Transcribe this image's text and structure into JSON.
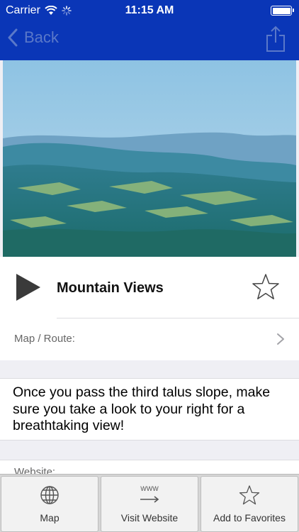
{
  "status_bar": {
    "carrier": "Carrier",
    "time": "11:15 AM"
  },
  "nav": {
    "back_label": "Back"
  },
  "item": {
    "title": "Mountain Views",
    "map_label": "Map / Route:",
    "description": "Once you pass the third talus slope, make sure you take a look to your right for a breathtaking view!",
    "website_label": "Website:"
  },
  "toolbar": {
    "buttons": [
      {
        "label": "Map",
        "icon": "globe-icon"
      },
      {
        "label": "Visit Website",
        "icon": "www-arrow-icon",
        "icon_text": "WWW"
      },
      {
        "label": "Add to Favorites",
        "icon": "star-outline-icon"
      }
    ]
  },
  "colors": {
    "nav_bar": "#0a36b7",
    "back_text": "#5a78c9",
    "background": "#efeff4"
  }
}
